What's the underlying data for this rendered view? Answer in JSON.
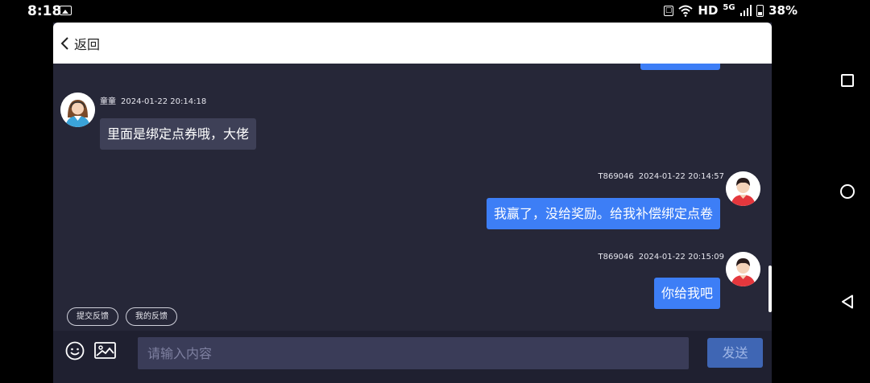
{
  "status_bar": {
    "time": "8:18",
    "hd": "HD",
    "network": "5G",
    "battery": "38%",
    "icons": [
      "gallery-icon",
      "nfc-icon",
      "wifi-icon",
      "signal-icon",
      "battery-icon"
    ]
  },
  "header": {
    "back_label": "返回",
    "icon": "chevron-left-icon"
  },
  "messages": [
    {
      "side": "in",
      "sender": "童童",
      "time": "2024-01-22 20:14:18",
      "text": "里面是绑定点券哦，大佬",
      "avatar": "agent-avatar"
    },
    {
      "side": "out",
      "sender": "T869046",
      "time": "2024-01-22 20:14:57",
      "text": "我赢了，没给奖励。给我补偿绑定点卷",
      "avatar": "user-avatar"
    },
    {
      "side": "out",
      "sender": "T869046",
      "time": "2024-01-22 20:15:09",
      "text": "你给我吧",
      "avatar": "user-avatar"
    }
  ],
  "chips": [
    "提交反馈",
    "我的反馈"
  ],
  "input": {
    "placeholder": "请输入内容",
    "value": "",
    "send_label": "发送",
    "icons": [
      "emoji-icon",
      "image-icon"
    ]
  },
  "colors": {
    "chat_bg": "#262738",
    "bubble_out": "#3d7ef6",
    "bubble_in": "#3e4057",
    "send_button": "#3f66b4"
  }
}
